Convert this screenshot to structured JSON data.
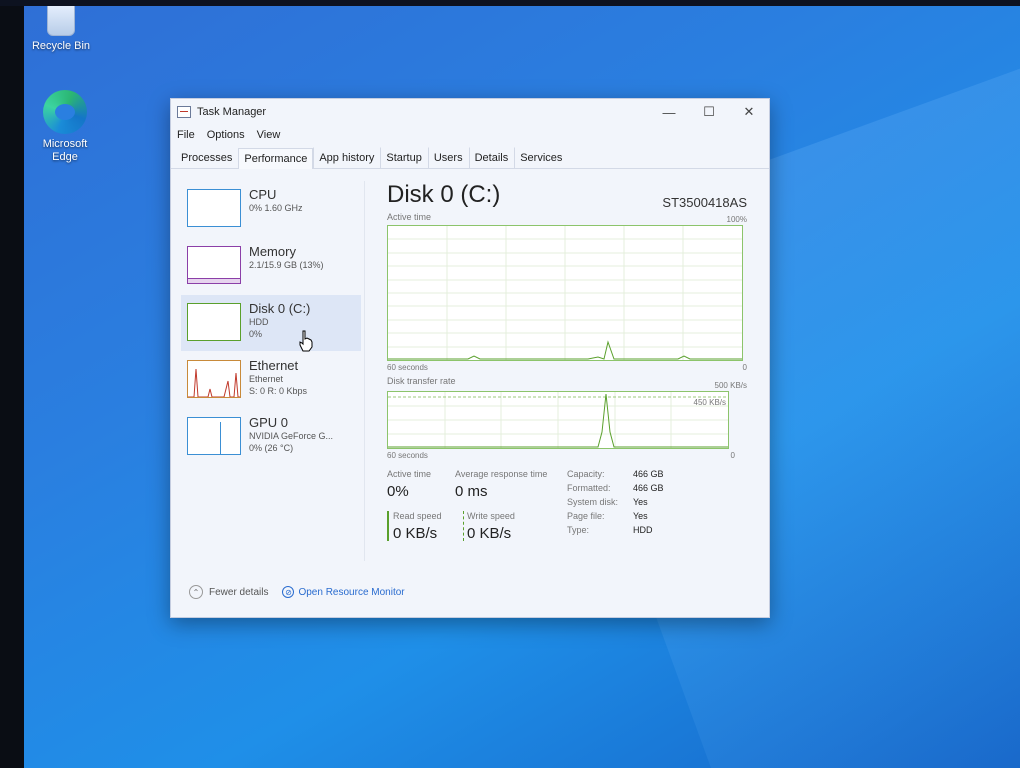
{
  "desktop": {
    "icons": [
      {
        "label": "Recycle Bin"
      },
      {
        "label": "Microsoft Edge"
      }
    ]
  },
  "window": {
    "title": "Task Manager",
    "controls": [
      "—",
      "☐",
      "✕"
    ]
  },
  "menu": [
    "File",
    "Options",
    "View"
  ],
  "tabs": [
    "Processes",
    "Performance",
    "App history",
    "Startup",
    "Users",
    "Details",
    "Services"
  ],
  "active_tab": "Performance",
  "sidebar": [
    {
      "name": "CPU",
      "sub1": "0% 1.60 GHz",
      "sub2": "",
      "sub3": ""
    },
    {
      "name": "Memory",
      "sub1": "2.1/15.9 GB (13%)",
      "sub2": "",
      "sub3": ""
    },
    {
      "name": "Disk 0 (C:)",
      "sub1": "HDD",
      "sub2": "0%",
      "sub3": ""
    },
    {
      "name": "Ethernet",
      "sub1": "Ethernet",
      "sub2": "S: 0 R: 0 Kbps",
      "sub3": ""
    },
    {
      "name": "GPU 0",
      "sub1": "NVIDIA GeForce G...",
      "sub2": "0% (26 °C)",
      "sub3": ""
    }
  ],
  "selected_sidebar": "Disk 0 (C:)",
  "detail": {
    "title": "Disk 0 (C:)",
    "model": "ST3500418AS",
    "active_time_label": "Active time",
    "active_time_max": "100%",
    "seconds_label": "60 seconds",
    "zero": "0",
    "transfer_label": "Disk transfer rate",
    "transfer_max": "500 KB/s",
    "transfer_line": "450 KB/s",
    "stats": {
      "active_time_label": "Active time",
      "active_time": "0%",
      "avg_response_label": "Average response time",
      "avg_response": "0 ms",
      "read_label": "Read speed",
      "read": "0 KB/s",
      "write_label": "Write speed",
      "write": "0 KB/s"
    },
    "props": [
      {
        "k": "Capacity:",
        "v": "466 GB"
      },
      {
        "k": "Formatted:",
        "v": "466 GB"
      },
      {
        "k": "System disk:",
        "v": "Yes"
      },
      {
        "k": "Page file:",
        "v": "Yes"
      },
      {
        "k": "Type:",
        "v": "HDD"
      }
    ]
  },
  "footer": {
    "fewer_details": "Fewer details",
    "open_monitor": "Open Resource Monitor"
  },
  "colors": {
    "disk_accent": "#5aa02c",
    "link": "#2a6ccf"
  }
}
